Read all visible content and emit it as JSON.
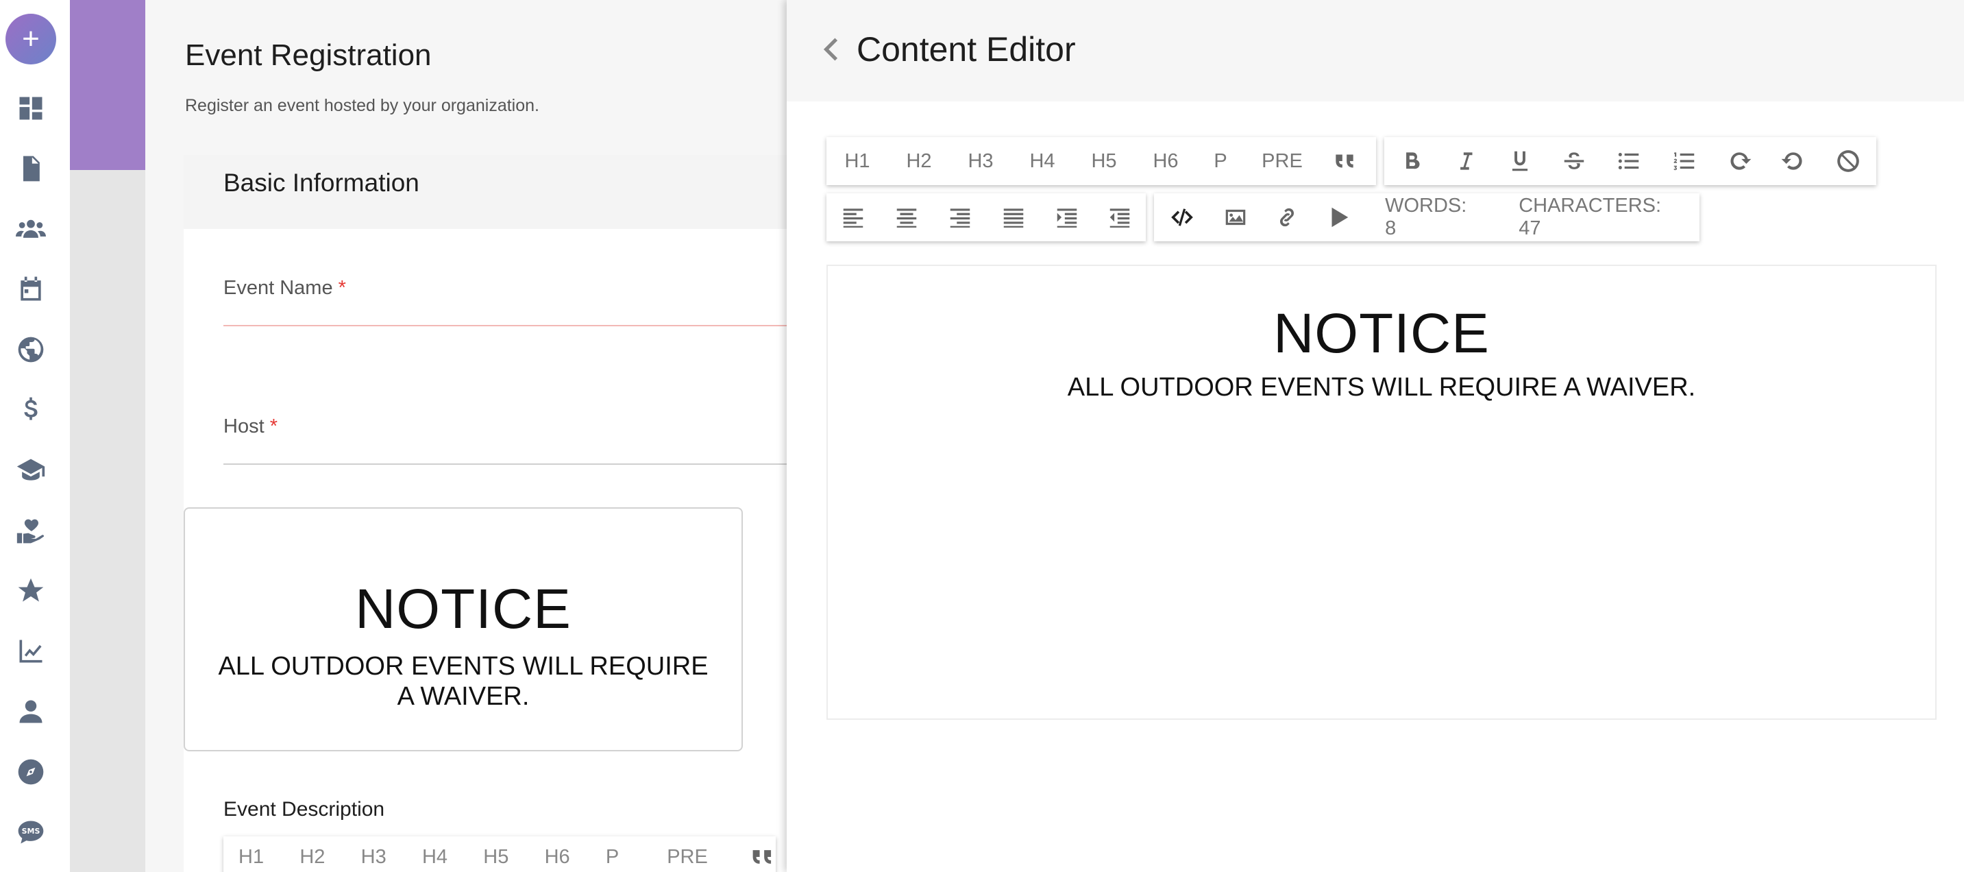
{
  "rail": {
    "add_label": "+",
    "icons": [
      "dashboard-icon",
      "document-icon",
      "users-icon",
      "calendar-icon",
      "globe-icon",
      "dollar-icon",
      "graduation-cap-icon",
      "hand-heart-icon",
      "star-icon",
      "chart-line-icon",
      "person-icon",
      "compass-icon",
      "sms-icon"
    ]
  },
  "page": {
    "title": "Event Registration",
    "subtitle": "Register an event hosted by your organization.",
    "section_title": "Basic Information",
    "fields": [
      {
        "label": "Event Name",
        "required_mark": "*"
      },
      {
        "label": "Host",
        "required_mark": "*"
      }
    ],
    "notice": {
      "heading": "NOTICE",
      "body": "ALL OUTDOOR EVENTS WILL REQUIRE A WAIVER."
    },
    "description_label": "Event Description",
    "mini_toolbar": [
      "H1",
      "H2",
      "H3",
      "H4",
      "H5",
      "H6",
      "P",
      "PRE"
    ]
  },
  "editor": {
    "title": "Content Editor",
    "heading_buttons": [
      "H1",
      "H2",
      "H3",
      "H4",
      "H5",
      "H6",
      "P",
      "PRE"
    ],
    "format_icons": [
      "quote-icon",
      "bold-icon",
      "italic-icon",
      "underline-icon",
      "strikethrough-icon",
      "bulleted-list-icon",
      "numbered-list-icon",
      "redo-icon",
      "undo-icon",
      "clear-format-icon"
    ],
    "align_icons": [
      "align-left-icon",
      "align-center-icon",
      "align-right-icon",
      "align-justify-icon",
      "indent-icon",
      "outdent-icon"
    ],
    "insert_icons": [
      "code-icon",
      "image-icon",
      "link-icon",
      "video-icon"
    ],
    "words_label": "WORDS: 8",
    "characters_label": "CHARACTERS: 47",
    "content": {
      "heading": "NOTICE",
      "body": "ALL OUTDOOR EVENTS WILL REQUIRE A WAIVER."
    }
  },
  "colors": {
    "accent_purple": "#a07fc8",
    "required_red": "#e53935",
    "icon_grey": "#5d6b80"
  }
}
